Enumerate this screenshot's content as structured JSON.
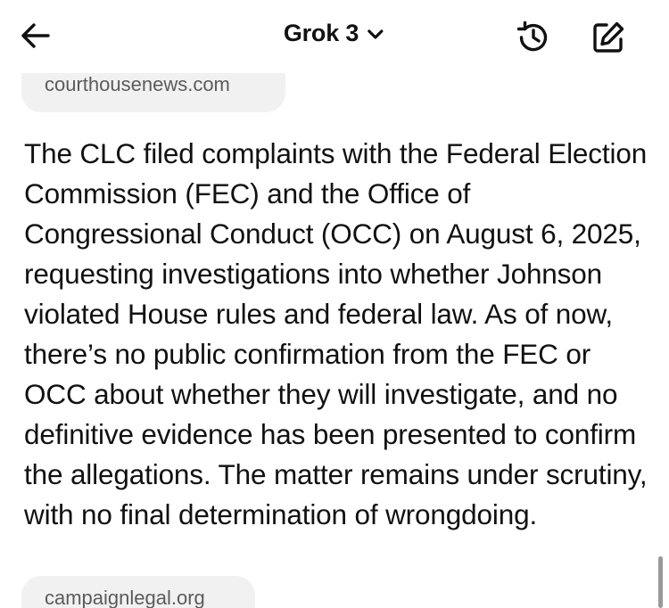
{
  "header": {
    "title": "Grok 3",
    "back_icon": "arrow-left-icon",
    "dropdown_icon": "chevron-down-icon",
    "history_icon": "history-icon",
    "compose_icon": "new-chat-edit-icon"
  },
  "message": {
    "source_top": "courthousenews.com",
    "text": "The CLC filed complaints with the Federal Election Commission (FEC) and the Office of Congressional Conduct (OCC) on August 6, 2025, requesting investigations into whether Johnson violated House rules and federal law. As of now, there’s no public confirmation from the FEC or OCC about whether they will investigate, and no definitive evidence has been presented to confirm the allegations. The matter remains under scrutiny, with no final determination of wrongdoing.",
    "source_bottom": "campaignlegal.org"
  },
  "colors": {
    "text": "#111111",
    "chip_bg": "#f1f1f1",
    "chip_text": "#5b5b5b",
    "background": "#ffffff"
  }
}
